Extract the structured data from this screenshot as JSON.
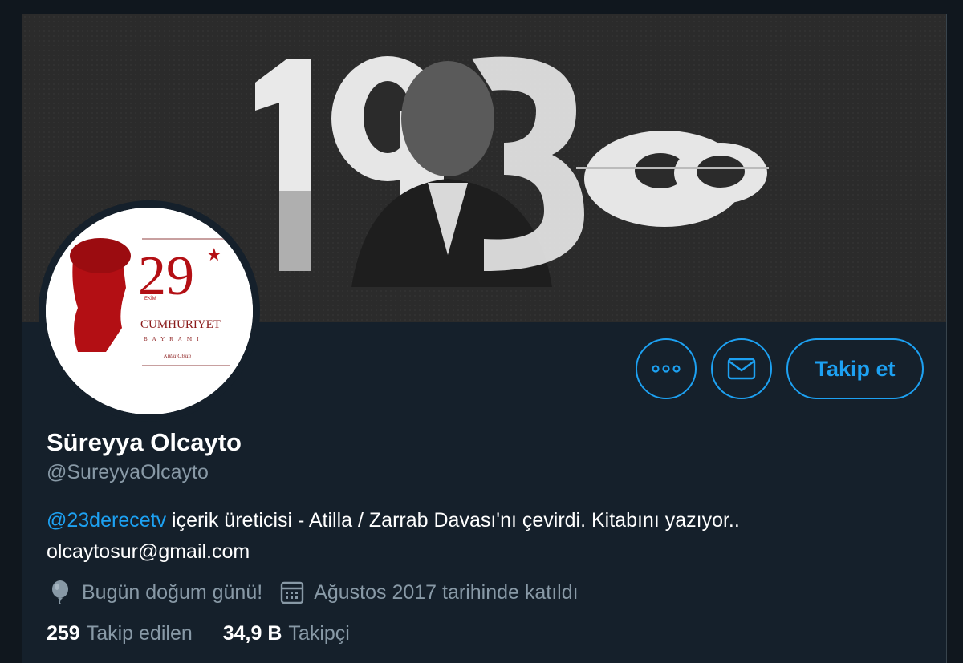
{
  "banner": {
    "image": "header-image-atatürk-1938"
  },
  "avatar": {
    "day": "29",
    "month": "EKİM",
    "line1": "CUMHURIYET",
    "line2": "BAYRAMI",
    "signature": "Kutlu Olsun"
  },
  "actions": {
    "more_icon": "more-icon",
    "message_icon": "envelope-icon",
    "follow_label": "Takip et"
  },
  "profile": {
    "display_name": "Süreyya Olcayto",
    "handle": "@SureyyaOlcayto",
    "bio_mention": "@23derecetv",
    "bio_text": " içerik üreticisi - Atilla / Zarrab Davası'nı çevirdi. Kitabını yazıyor..",
    "bio_line2": "olcaytosur@gmail.com",
    "birthday": "Bugün doğum günü!",
    "joined": "Ağustos 2017 tarihinde katıldı"
  },
  "stats": {
    "following_count": "259",
    "following_label": "Takip edilen",
    "followers_count": "34,9 B",
    "followers_label": "Takipçi"
  },
  "colors": {
    "background": "#15202b",
    "accent": "#1da1f2",
    "muted": "#8899a6"
  }
}
